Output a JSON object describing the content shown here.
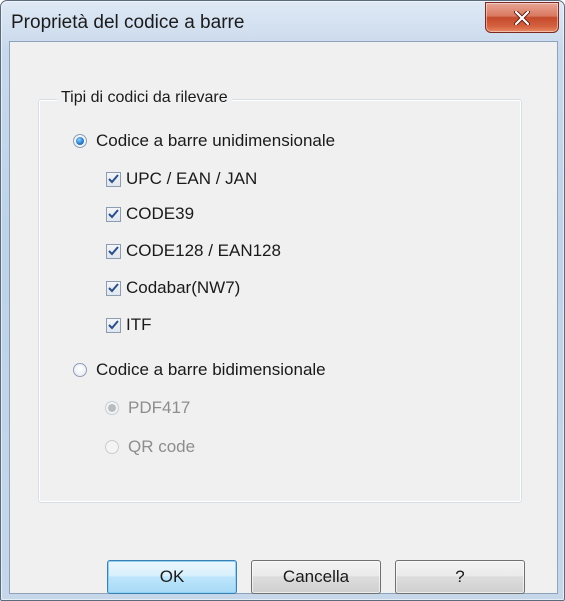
{
  "window": {
    "title": "Proprietà del codice a barre"
  },
  "group": {
    "label": "Tipi di codici da rilevare"
  },
  "one_d": {
    "label": "Codice a barre unidimensionale",
    "selected": true,
    "items": [
      {
        "label": "UPC / EAN / JAN",
        "checked": true
      },
      {
        "label": "CODE39",
        "checked": true
      },
      {
        "label": "CODE128 / EAN128",
        "checked": true
      },
      {
        "label": "Codabar(NW7)",
        "checked": true
      },
      {
        "label": "ITF",
        "checked": true
      }
    ]
  },
  "two_d": {
    "label": "Codice a barre bidimensionale",
    "selected": false,
    "options": [
      {
        "label": "PDF417",
        "selected": true,
        "enabled": false
      },
      {
        "label": "QR code",
        "selected": false,
        "enabled": false
      }
    ]
  },
  "buttons": {
    "ok": "OK",
    "cancel": "Cancella",
    "help": "?"
  },
  "colors": {
    "accent": "#2a7ccb",
    "close_button": "#c44a2c"
  }
}
